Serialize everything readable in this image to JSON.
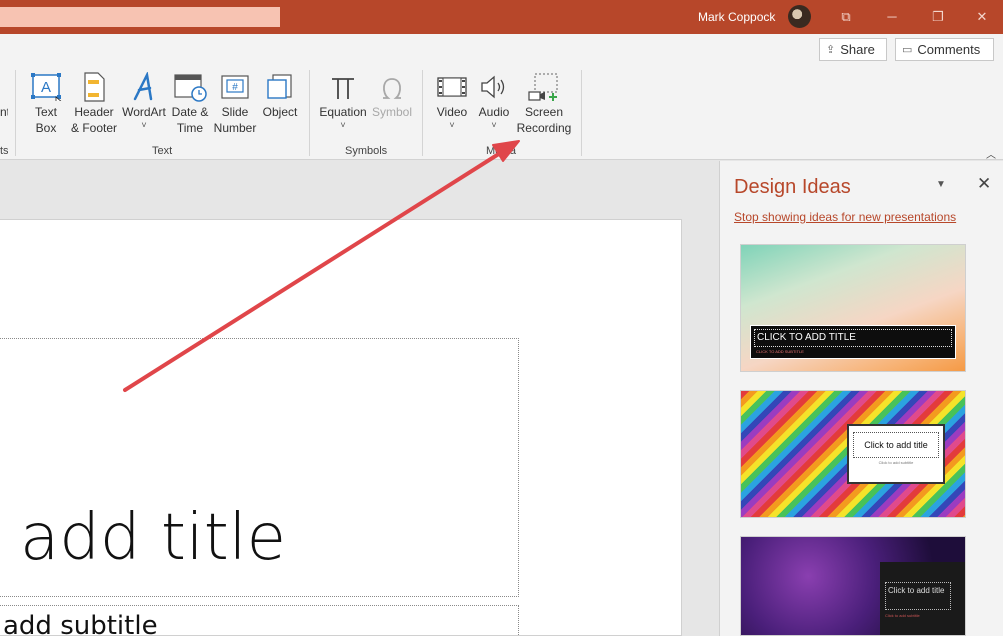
{
  "titlebar": {
    "user_name": "Mark Coppock",
    "restore_glyph": "⧉",
    "minimize_glyph": "─",
    "maximize_glyph": "❐",
    "close_glyph": "✕"
  },
  "ribbon": {
    "share_label": "Share",
    "comments_label": "Comments",
    "text_group": {
      "label": "Text",
      "buttons": [
        {
          "line1": "Text",
          "line2": "Box",
          "icon": "text-box-icon"
        },
        {
          "line1": "Header",
          "line2": "& Footer",
          "icon": "header-footer-icon"
        },
        {
          "line1": "WordArt",
          "line2": "˅",
          "icon": "wordart-icon"
        },
        {
          "line1": "Date &",
          "line2": "Time",
          "icon": "date-time-icon"
        },
        {
          "line1": "Slide",
          "line2": "Number",
          "icon": "slide-number-icon"
        },
        {
          "line1": "Object",
          "line2": "",
          "icon": "object-icon"
        }
      ]
    },
    "symbols_group": {
      "label": "Symbols",
      "equation_label": "Equation",
      "symbol_label": "Symbol"
    },
    "media_group": {
      "label": "Media",
      "video_label": "Video",
      "audio_label": "Audio",
      "screen_line1": "Screen",
      "screen_line2": "Recording"
    },
    "partial_left_label": "nt",
    "partial_left_group": "ts"
  },
  "slide": {
    "title_text": "add title",
    "subtitle_text": "add subtitle"
  },
  "design_ideas": {
    "title": "Design Ideas",
    "stop_link": "Stop showing ideas for new presentations",
    "thumbs": [
      {
        "title": "CLICK TO ADD TITLE",
        "subtitle": "CLICK TO ADD SUBTITLE"
      },
      {
        "title": "Click to add title",
        "subtitle": "Click to add subtitle"
      },
      {
        "title": "Click to add title",
        "subtitle": "Click to add subtitle"
      }
    ]
  },
  "colors": {
    "accent": "#b7472a",
    "annotation_arrow": "#e0464a"
  }
}
